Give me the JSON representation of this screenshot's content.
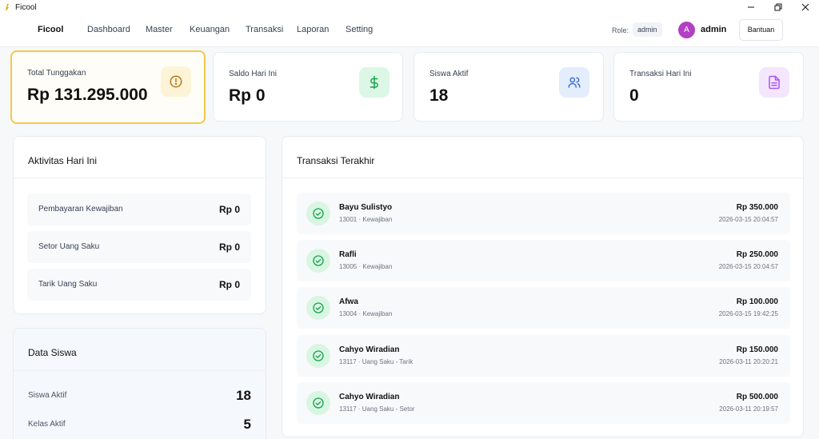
{
  "window": {
    "title": "Ficool"
  },
  "nav": {
    "brand": "Ficool",
    "items": [
      "Dashboard",
      "Master",
      "Keuangan",
      "Transaksi",
      "Laporan",
      "Setting"
    ],
    "role_label": "Role:",
    "role_value": "admin",
    "avatar_letter": "A",
    "user_name": "admin",
    "help_label": "Bantuan"
  },
  "stats": [
    {
      "label": "Total Tunggakan",
      "value": "Rp 131.295.000",
      "icon": "alert-circle-icon",
      "color": "#d4a017"
    },
    {
      "label": "Saldo Hari Ini",
      "value": "Rp 0",
      "icon": "dollar-icon",
      "color": "#16a34a"
    },
    {
      "label": "Siswa Aktif",
      "value": "18",
      "icon": "users-icon",
      "color": "#3b6fd8"
    },
    {
      "label": "Transaksi Hari Ini",
      "value": "0",
      "icon": "document-icon",
      "color": "#a855f7"
    }
  ],
  "activity": {
    "title": "Aktivitas Hari Ini",
    "rows": [
      {
        "label": "Pembayaran Kewajiban",
        "value": "Rp 0"
      },
      {
        "label": "Setor Uang Saku",
        "value": "Rp 0"
      },
      {
        "label": "Tarik Uang Saku",
        "value": "Rp 0"
      }
    ]
  },
  "data_siswa": {
    "title": "Data Siswa",
    "rows": [
      {
        "label": "Siswa Aktif",
        "value": "18"
      },
      {
        "label": "Kelas Aktif",
        "value": "5"
      }
    ]
  },
  "transactions": {
    "title": "Transaksi Terakhir",
    "items": [
      {
        "name": "Bayu Sulistyo",
        "sub": "13001 · Kewajiban",
        "amount": "Rp 350.000",
        "time": "2026-03-15 20:04:57"
      },
      {
        "name": "Rafli",
        "sub": "13005 · Kewajiban",
        "amount": "Rp 250.000",
        "time": "2026-03-15 20:04:57"
      },
      {
        "name": "Afwa",
        "sub": "13004 · Kewajiban",
        "amount": "Rp 100.000",
        "time": "2026-03-15 19:42:25"
      },
      {
        "name": "Cahyo Wiradian",
        "sub": "13117 · Uang Saku - Tarik",
        "amount": "Rp 150.000",
        "time": "2026-03-11 20:20:21"
      },
      {
        "name": "Cahyo Wiradian",
        "sub": "13117 · Uang Saku - Setor",
        "amount": "Rp 500.000",
        "time": "2026-03-11 20:19:57"
      }
    ]
  }
}
